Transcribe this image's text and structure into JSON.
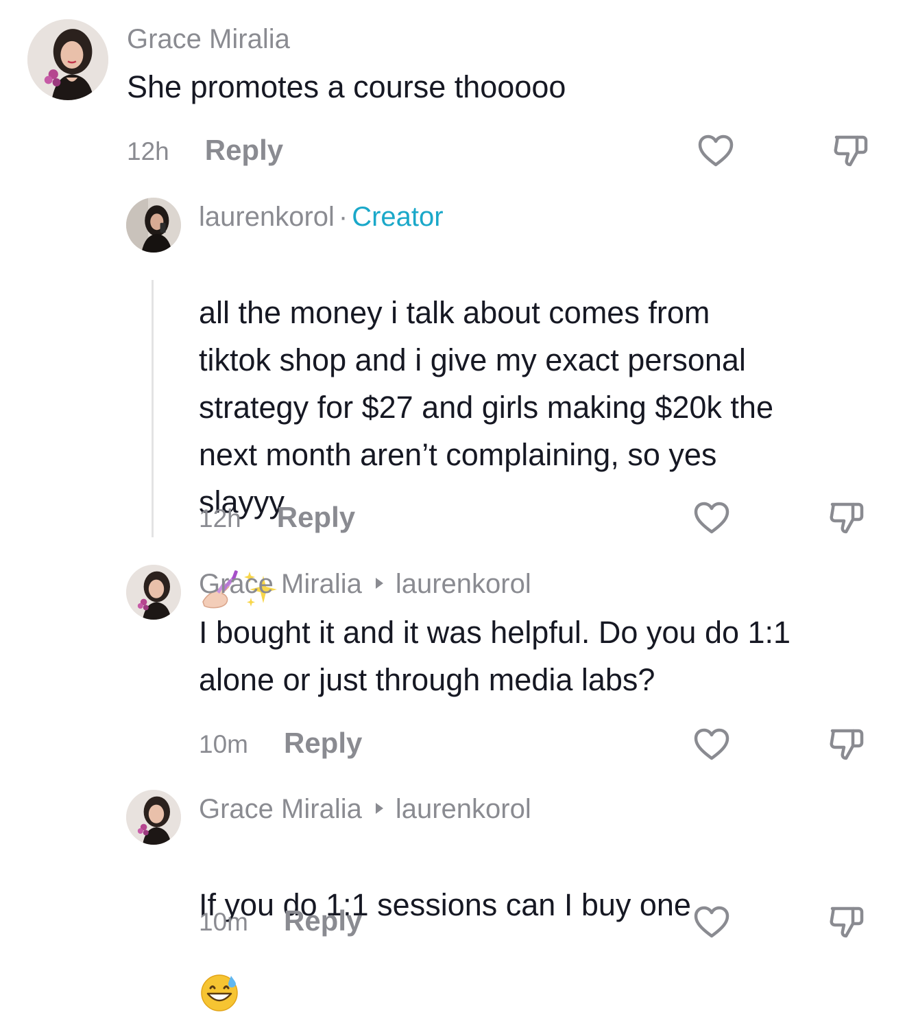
{
  "comments": [
    {
      "username": "Grace Miralia",
      "text": "She promotes a course thooooo",
      "time": "12h",
      "reply_label": "Reply"
    },
    {
      "username": "laurenkorol",
      "badge": "Creator",
      "separator": "·",
      "text": "all the money i talk about comes from\ntiktok shop and i give my exact personal\nstrategy for $27 and girls making $20k the\nnext month aren’t complaining, so yes\nslayyy",
      "emojis": [
        "nail-polish-emoji",
        "sparkles-emoji"
      ],
      "time": "12h",
      "reply_label": "Reply"
    },
    {
      "username": "Grace Miralia",
      "reply_to": "laurenkorol",
      "text": "I bought it and it was helpful. Do you do 1:1\nalone or just through media labs?",
      "time": "10m",
      "reply_label": "Reply"
    },
    {
      "username": "Grace Miralia",
      "reply_to": "laurenkorol",
      "text": "If you do 1:1 sessions can I buy one",
      "emojis": [
        "grinning-sweat-emoji"
      ],
      "time": "10m",
      "reply_label": "Reply"
    }
  ],
  "icons": {
    "like": "heart-outline-icon",
    "dislike": "thumbs-down-outline-icon"
  },
  "colors": {
    "text": "#161823",
    "secondary": "#8a8b91",
    "creator_badge": "#1aa8c9",
    "thread_line": "#e3e3e4"
  }
}
